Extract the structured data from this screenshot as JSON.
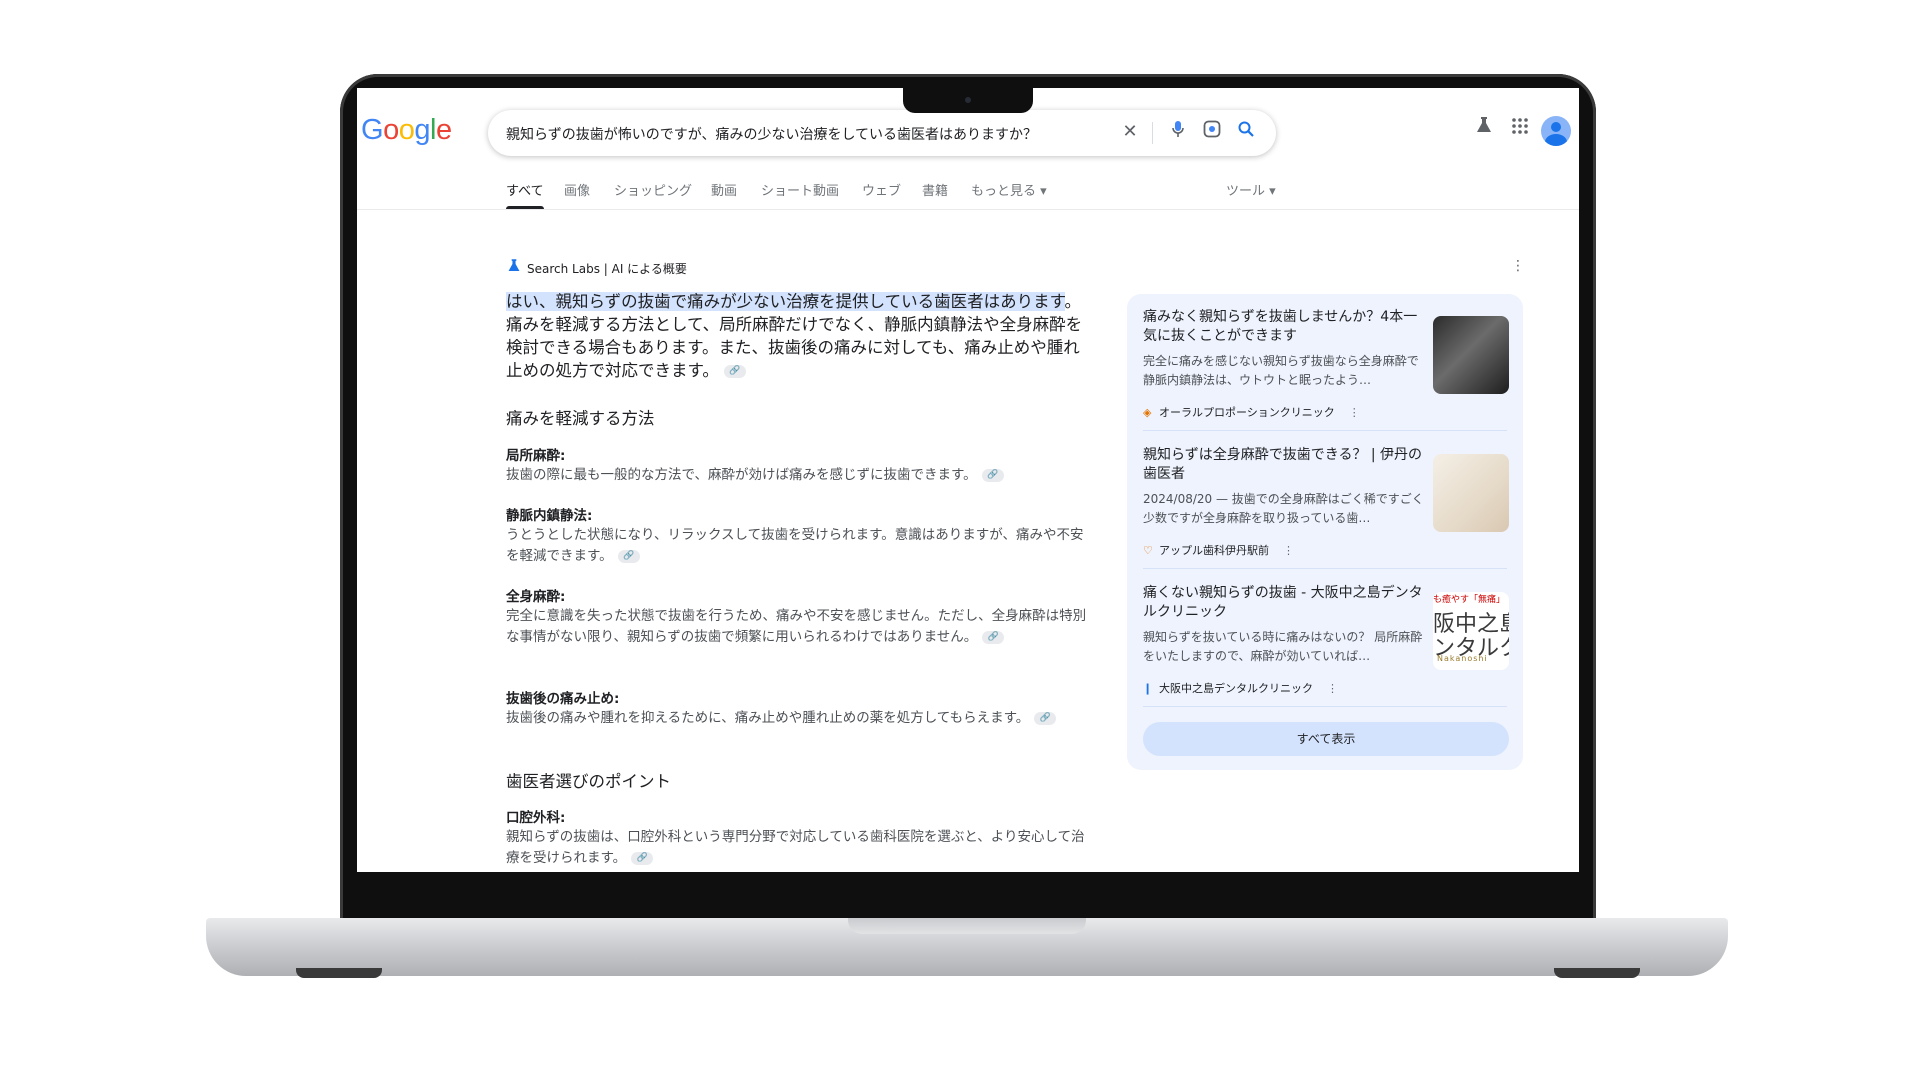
{
  "search": {
    "logo_letters": [
      "G",
      "o",
      "o",
      "g",
      "l",
      "e"
    ],
    "query": "親知らずの抜歯が怖いのですが、痛みの少ない治療をしている歯医者はありますか？",
    "icons": [
      "close-icon",
      "mic-icon",
      "lens-icon",
      "search-icon"
    ]
  },
  "header_icons": [
    "labs-flask-icon",
    "apps-grid-icon",
    "account-avatar"
  ],
  "tabs": [
    "すべて",
    "画像",
    "ショッピング",
    "動画",
    "ショート動画",
    "ウェブ",
    "書籍",
    "もっと見る ▾",
    "ツール ▾"
  ],
  "ai_overview": {
    "label": "Search Labs | AI による概要",
    "intro_highlight": "はい、親知らずの抜歯で痛みが少ない治療を提供している歯医者はあります",
    "intro_rest": "。痛みを軽減する方法として、局所麻酔だけでなく、静脈内鎮静法や全身麻酔を検討できる場合もあります。また、抜歯後の痛みに対しても、痛み止めや腫れ止めの処方で対応できます。",
    "section1_title": "痛みを軽減する方法",
    "items": [
      {
        "title": "局所麻酔:",
        "text": "抜歯の際に最も一般的な方法で、麻酔が効けば痛みを感じずに抜歯できます。"
      },
      {
        "title": "静脈内鎮静法:",
        "text": "うとうとした状態になり、リラックスして抜歯を受けられます。意識はありますが、痛みや不安を軽減できます。"
      },
      {
        "title": "全身麻酔:",
        "text": "完全に意識を失った状態で抜歯を行うため、痛みや不安を感じません。ただし、全身麻酔は特別な事情がない限り、親知らずの抜歯で頻繁に用いられるわけではありません。"
      },
      {
        "title": "抜歯後の痛み止め:",
        "text": "抜歯後の痛みや腫れを抑えるために、痛み止めや腫れ止めの薬を処方してもらえます。"
      }
    ],
    "section2_title": "歯医者選びのポイント",
    "items2": [
      {
        "title": "口腔外科:",
        "text": "親知らずの抜歯は、口腔外科という専門分野で対応している歯科医院を選ぶと、より安心して治療を受けられます。"
      }
    ]
  },
  "sources": [
    {
      "title": "痛みなく親知らずを抜歯しませんか？4本一気に抜くことができます",
      "snippet": "完全に痛みを感じない親知らず抜歯なら全身麻酔で 静脈内鎮静法は、ウトウトと眠ったよう…",
      "site": "オーラルプロポーションクリニック"
    },
    {
      "title": "親知らずは全身麻酔で抜歯できる？ | 伊丹の歯医者",
      "snippet": "2024/08/20 — 抜歯での全身麻酔はごく稀ですごく少数ですが全身麻酔を取り扱っている歯…",
      "site": "アップル歯科伊丹駅前"
    },
    {
      "title": "痛くない親知らずの抜歯 - 大阪中之島デンタルクリニック",
      "snippet": "親知らずを抜いている時に痛みはないの？ 局所麻酔をいたしますので、麻酔が効いていれば…",
      "site": "大阪中之島デンタルクリニック"
    }
  ],
  "thumb3": {
    "top": "も癒やす「無痛」",
    "main": "阪中之島",
    "main2": "ンタルク",
    "bottom": "Nakanoshi"
  },
  "show_all": "すべて表示",
  "colors": {
    "highlight": "#d3e3fd",
    "card_bg": "#eef3fd",
    "accent": "#1a73e8"
  }
}
